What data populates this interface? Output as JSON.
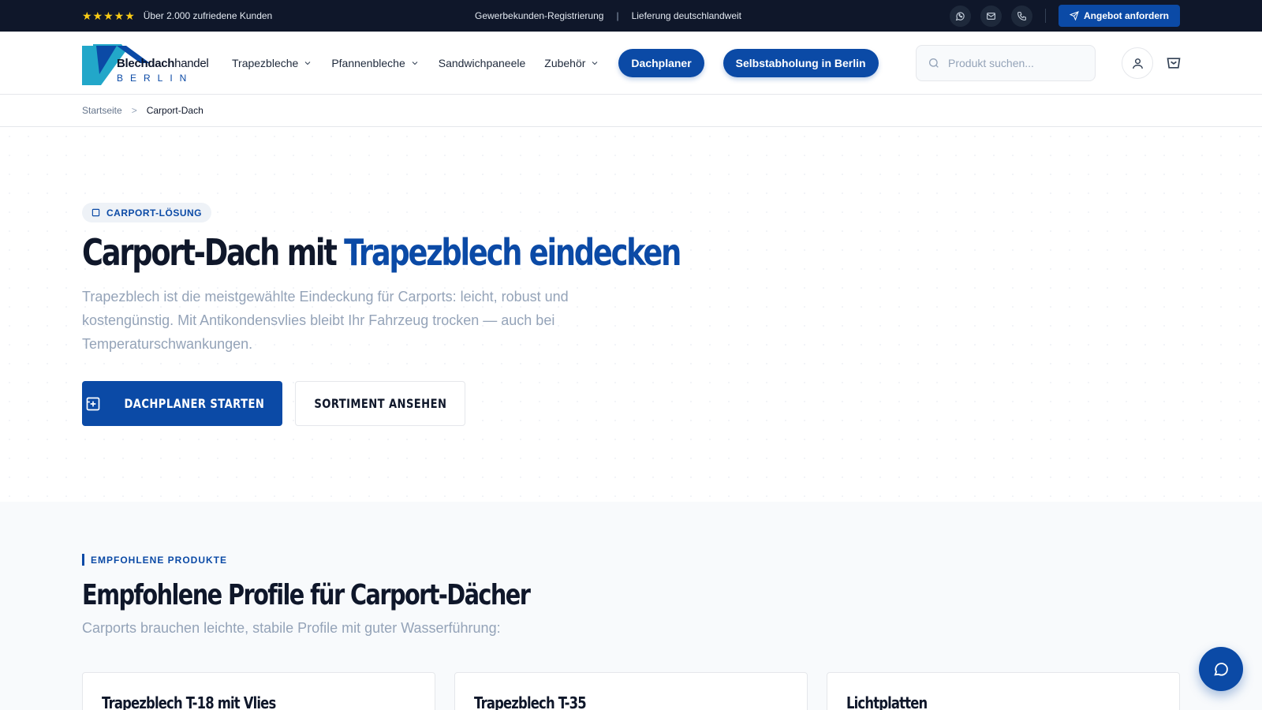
{
  "topbar": {
    "rating_text": "Über 2.000 zufriedene Kunden",
    "stars": "★★★★★",
    "link_business": "Gewerbekunden-Registrierung",
    "divider": "|",
    "link_delivery": "Lieferung deutschlandweit",
    "icons": [
      "whatsapp-icon",
      "mail-icon",
      "phone-icon"
    ],
    "offer_label": "Angebot anfordern"
  },
  "header": {
    "logo": {
      "main_bold": "Blechdach",
      "main_light": "handel",
      "sub": "BERLIN"
    },
    "nav": [
      {
        "label": "Trapezbleche",
        "dropdown": true
      },
      {
        "label": "Pfannenbleche",
        "dropdown": true
      },
      {
        "label": "Sandwichpaneele",
        "dropdown": false
      },
      {
        "label": "Zubehör",
        "dropdown": true
      }
    ],
    "pill_planner": "Dachplaner",
    "pill_pickup": "Selbstabholung in Berlin",
    "search_placeholder": "Produkt suchen..."
  },
  "breadcrumb": {
    "home": "Startseite",
    "separator": ">",
    "current": "Carport-Dach"
  },
  "hero": {
    "badge": "CARPORT-LÖSUNG",
    "title_part1": "Carport-Dach mit ",
    "title_highlight": "Trapezblech eindecken",
    "lead": "Trapezblech ist die meistgewählte Eindeckung für Carports: leicht, robust und kostengünstig. Mit Antikondensvlies bleibt Ihr Fahrzeug trocken — auch bei Temperaturschwankungen.",
    "btn_primary": "DACHPLANER STARTEN",
    "btn_secondary": "SORTIMENT ANSEHEN"
  },
  "products": {
    "eyebrow": "EMPFOHLENE PRODUKTE",
    "title": "Empfohlene Profile für Carport-Dächer",
    "subtitle": "Carports brauchen leichte, stabile Profile mit guter Wasserführung:",
    "cards": [
      {
        "title": "Trapezblech T-18 mit Vlies"
      },
      {
        "title": "Trapezblech T-35"
      },
      {
        "title": "Lichtplatten"
      }
    ]
  },
  "colors": {
    "brand_blue": "#0b4aa6",
    "topbar_bg": "#0f172a",
    "star_yellow": "#facc15"
  }
}
